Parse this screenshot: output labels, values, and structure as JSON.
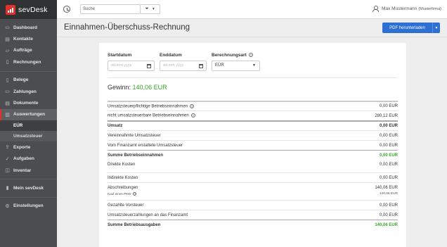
{
  "app": {
    "logo_text": "sevDesk"
  },
  "sidebar": {
    "items": [
      {
        "label": "Dashboard",
        "icon": "dashboard-icon"
      },
      {
        "label": "Kontakte",
        "icon": "contacts-icon"
      },
      {
        "label": "Aufträge",
        "icon": "orders-icon"
      },
      {
        "label": "Rechnungen",
        "icon": "invoice-icon"
      },
      {
        "label": "Belege",
        "icon": "receipt-icon"
      },
      {
        "label": "Zahlungen",
        "icon": "payments-icon"
      },
      {
        "label": "Dokumente",
        "icon": "documents-icon"
      },
      {
        "label": "Auswertungen",
        "icon": "chart-icon"
      },
      {
        "label": "EÜR",
        "icon": ""
      },
      {
        "label": "Umsatzsteuer",
        "icon": ""
      },
      {
        "label": "Exporte",
        "icon": "export-icon"
      },
      {
        "label": "Aufgaben",
        "icon": "check-icon"
      },
      {
        "label": "Inventar",
        "icon": "inventory-icon"
      },
      {
        "label": "Mein sevDesk",
        "icon": "sevdesk-icon"
      },
      {
        "label": "Einstellungen",
        "icon": "gear-icon"
      }
    ]
  },
  "topbar": {
    "search_value": "Suche",
    "user_name": "Max Mustermann",
    "user_company": "(Musterfirma)"
  },
  "header": {
    "title": "Einnahmen-Überschuss-Rechnung",
    "pdf_button": "PDF herunterladen"
  },
  "filters": {
    "start_label": "Startdatum",
    "start_placeholder": "dd.mm.yyyy",
    "end_label": "Enddatum",
    "end_placeholder": "dd.mm.yyyy",
    "calc_label": "Berechnungsart",
    "calc_value": "EÜR"
  },
  "gewinn": {
    "label": "Gewinn:",
    "value": "140,06 EUR"
  },
  "rows": [
    {
      "label": "Umsatzsteuerpflichtige Betriebseinnahmen",
      "value": "0,00 EUR"
    },
    {
      "label": "nicht umsatzsteuerbare Betriebseinnahmen",
      "value": "280,12 EUR"
    },
    {
      "label": "Umsatz",
      "value": "0,00 EUR"
    },
    {
      "label": "Vereinnahmte Umsatzsteuer",
      "value": "0,00 EUR"
    },
    {
      "label": "Vom Finanzamt erstattete Umsatzsteuer",
      "value": "0,00 EUR"
    },
    {
      "label": "Summe Betriebseinnahmen",
      "value": "0,00 EUR"
    },
    {
      "label": "Direkte Kosten",
      "value": "0,00 EUR"
    },
    {
      "label": "Indirekte Kosten",
      "value": "0,00 EUR"
    },
    {
      "label": "Abschreibungen",
      "value": "140,06 EUR"
    },
    {
      "label": "Kauf eines PKW",
      "value": "140,06 EUR"
    },
    {
      "label": "Gezahlte Vorsteuer",
      "value": "0,00 EUR"
    },
    {
      "label": "Umsatzsteuerzahlungen an das Finanzamt",
      "value": "0,00 EUR"
    },
    {
      "label": "Summe Betriebsausgaben",
      "value": "140,06 EUR"
    }
  ],
  "colors": {
    "brand_red": "#e2312d",
    "accent_blue": "#2d6fd2",
    "positive_green": "#37a52b",
    "sidebar_bg": "#4b4d50"
  }
}
